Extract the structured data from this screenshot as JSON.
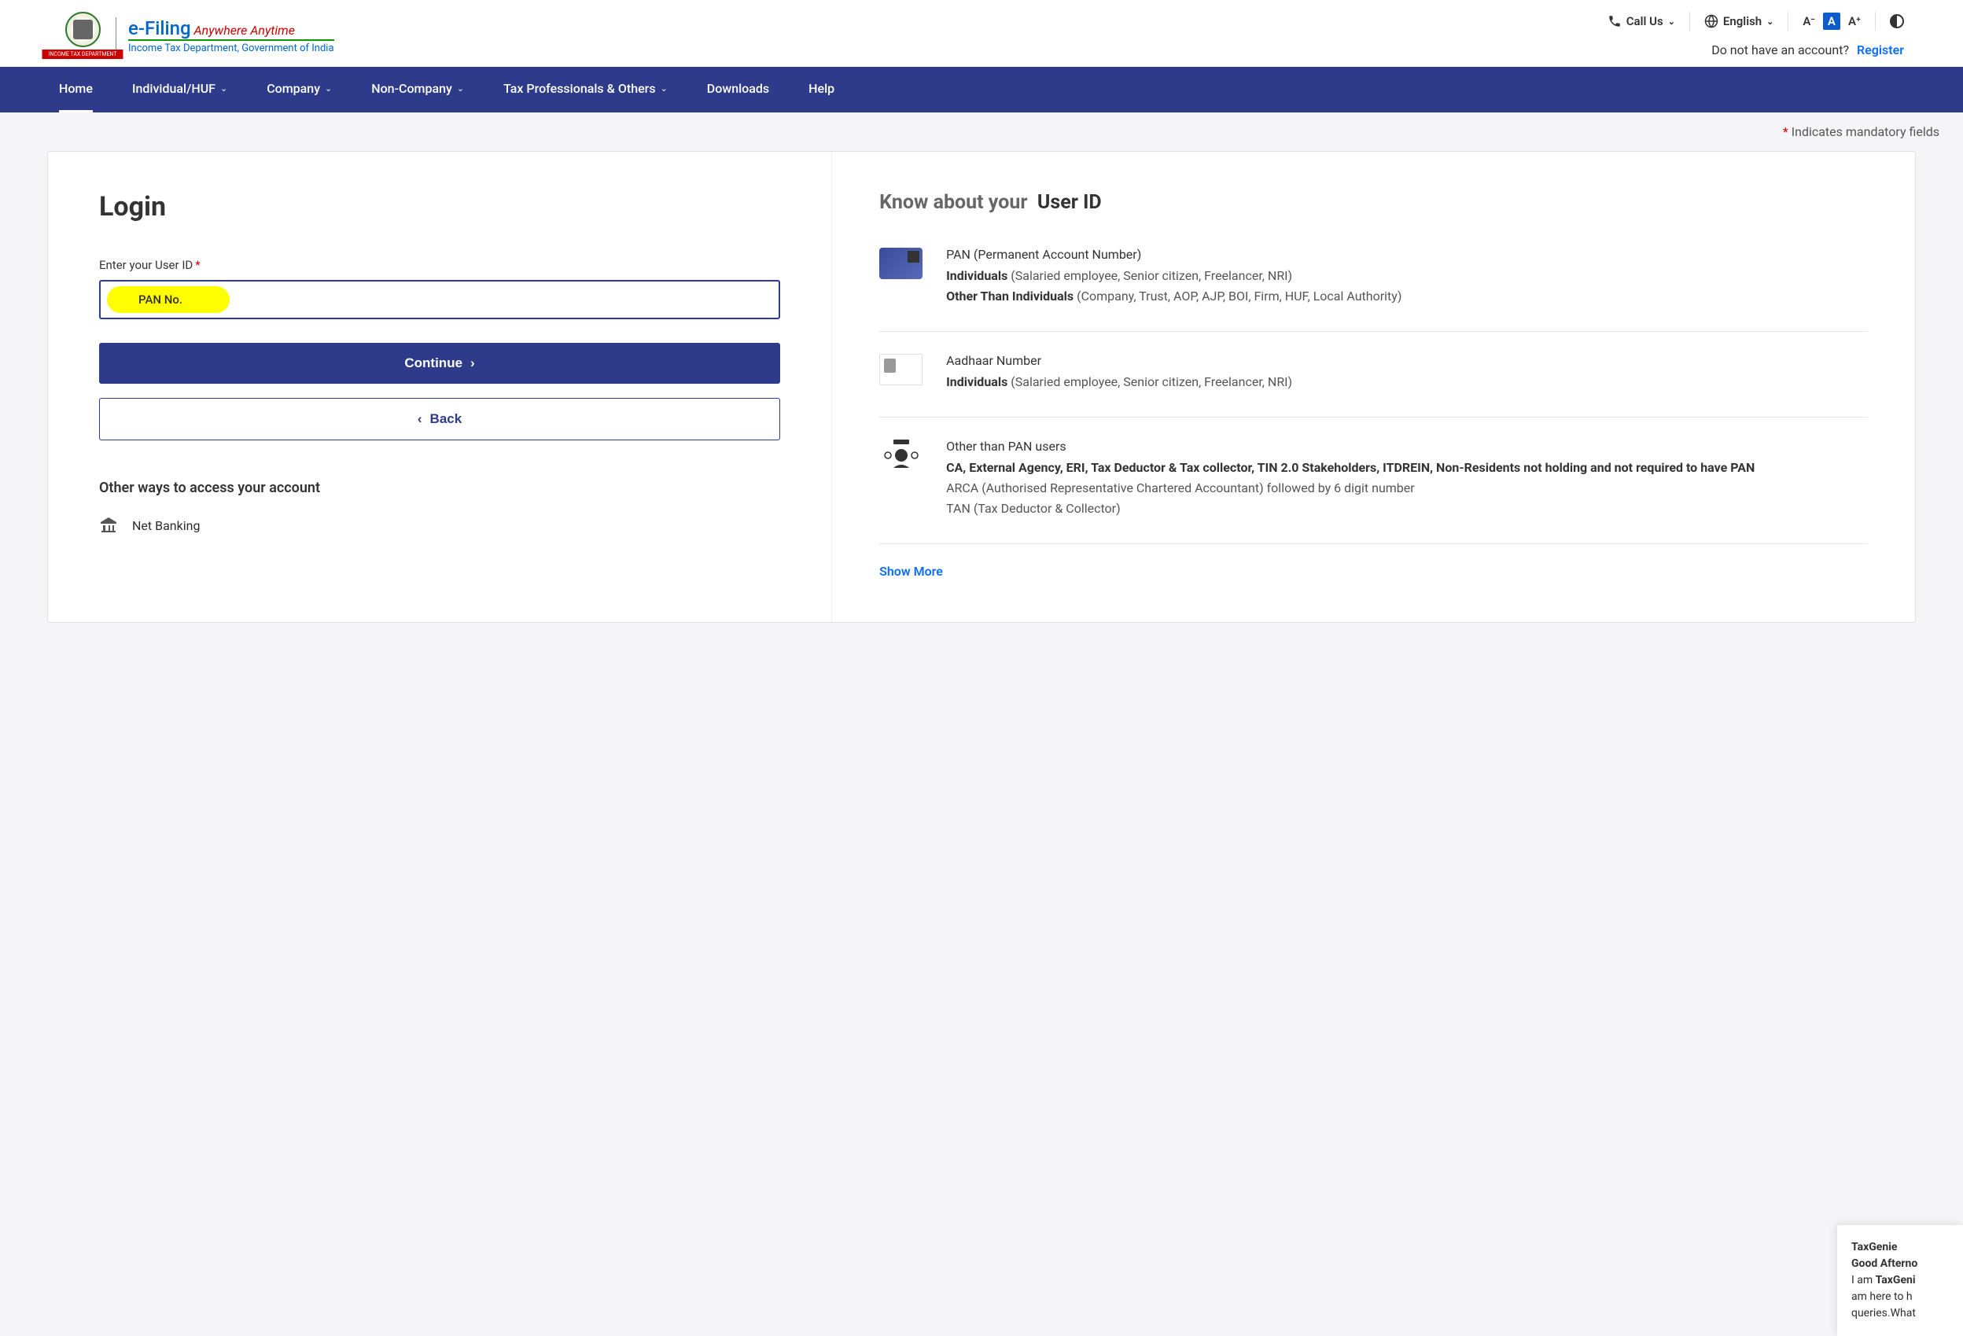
{
  "header": {
    "brand_main": "e-Filing",
    "brand_tagline": "Anywhere Anytime",
    "brand_sub": "Income Tax Department, Government of India",
    "emblem_ribbon": "INCOME TAX DEPARTMENT",
    "call_us": "Call Us",
    "language": "English",
    "font_decrease": "A⁻",
    "font_normal": "A",
    "font_increase": "A⁺",
    "no_account": "Do not have an account?",
    "register": "Register"
  },
  "nav": {
    "home": "Home",
    "individual": "Individual/HUF",
    "company": "Company",
    "non_company": "Non-Company",
    "tax_pro": "Tax Professionals & Others",
    "downloads": "Downloads",
    "help": "Help"
  },
  "mandatory_text": "Indicates mandatory fields",
  "login": {
    "title": "Login",
    "user_id_label": "Enter your User ID",
    "highlight": "PAN No.",
    "continue": "Continue",
    "back": "Back",
    "other_ways": "Other ways to access your account",
    "net_banking": "Net Banking"
  },
  "info": {
    "title_prefix": "Know about your",
    "title_bold": "User ID",
    "pan": {
      "heading": "PAN (Permanent Account Number)",
      "ind_label": "Individuals",
      "ind_desc": "(Salaried employee, Senior citizen, Freelancer, NRI)",
      "other_label": "Other Than Individuals",
      "other_desc": "(Company, Trust, AOP, AJP, BOI, Firm, HUF, Local Authority)"
    },
    "aadhaar": {
      "heading": "Aadhaar Number",
      "ind_label": "Individuals",
      "ind_desc": "(Salaried employee, Senior citizen, Freelancer, NRI)"
    },
    "other": {
      "heading": "Other than PAN users",
      "line1": "CA, External Agency, ERI, Tax Deductor & Tax collector, TIN 2.0 Stakeholders, ITDREIN, Non-Residents not holding and not required to have PAN",
      "line2": "ARCA (Authorised Representative Chartered Accountant) followed by 6 digit number",
      "line3": "TAN (Tax Deductor & Collector)"
    },
    "show_more": "Show More"
  },
  "chatbot": {
    "name": "TaxGenie",
    "greeting": "Good Afterno",
    "line1_prefix": "I am ",
    "line1_bold": "TaxGeni",
    "line2": "am here to h",
    "line3": "queries.What"
  }
}
